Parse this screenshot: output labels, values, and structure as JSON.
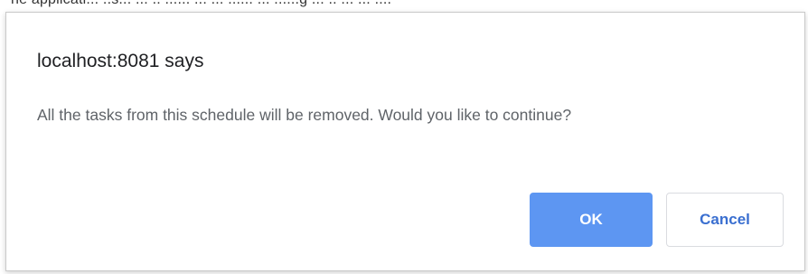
{
  "background": {
    "partial_text": "ne applicati... ..s... ... .. ...... ... ...  ...... ... ......g ... .. ... ... ...."
  },
  "dialog": {
    "title": "localhost:8081 says",
    "message": "All the tasks from this schedule will be removed. Would you like to continue?",
    "ok_label": "OK",
    "cancel_label": "Cancel"
  },
  "colors": {
    "ok_bg": "#5d96f2",
    "cancel_text": "#3a6fd0",
    "title_text": "#202124",
    "message_text": "#5f6368"
  }
}
